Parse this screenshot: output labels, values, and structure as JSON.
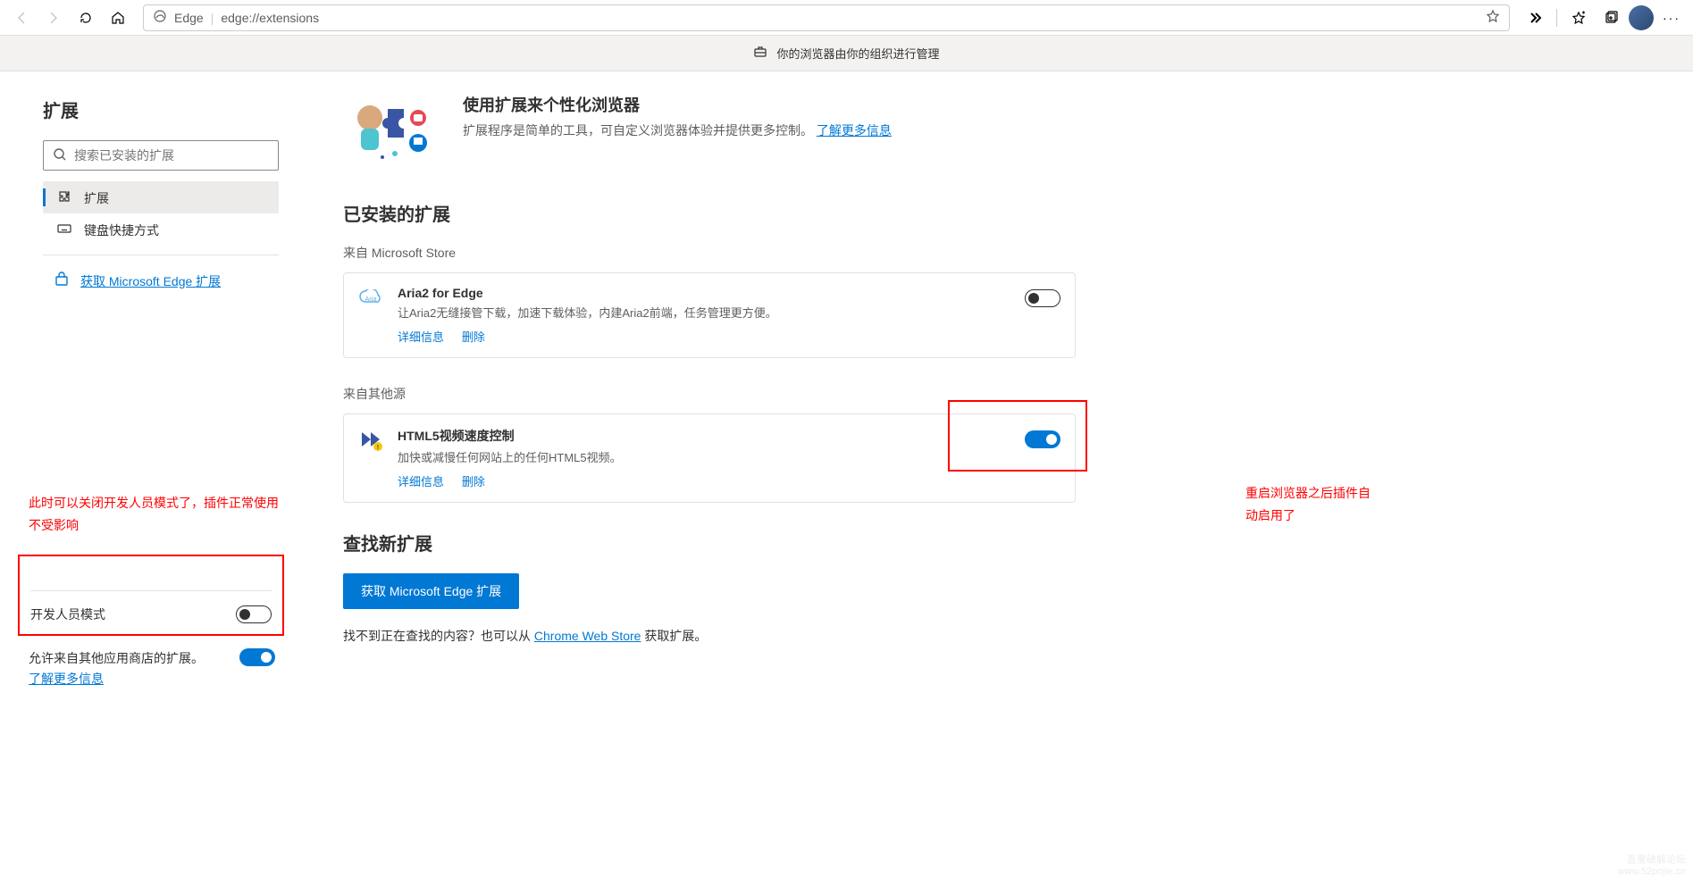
{
  "chrome": {
    "edge_label": "Edge",
    "url": "edge://extensions"
  },
  "banner": {
    "text": "你的浏览器由你的组织进行管理"
  },
  "sidebar": {
    "title": "扩展",
    "search_placeholder": "搜索已安装的扩展",
    "nav_extensions": "扩展",
    "nav_shortcuts": "键盘快捷方式",
    "get_link": "获取 Microsoft Edge 扩展",
    "annotation1": "此时可以关闭开发人员模式了，插件正常使用不受影响",
    "dev_mode_label": "开发人员模式",
    "allow_other_prefix": "允许来自其他应用商店的扩展。",
    "allow_other_link": "了解更多信息"
  },
  "main": {
    "hero_title": "使用扩展来个性化浏览器",
    "hero_desc": "扩展程序是简单的工具，可自定义浏览器体验并提供更多控制。",
    "hero_link": "了解更多信息",
    "installed_title": "已安装的扩展",
    "from_store": "来自 Microsoft Store",
    "from_other": "来自其他源",
    "ext1": {
      "title": "Aria2 for Edge",
      "desc": "让Aria2无缝接管下载，加速下载体验，内建Aria2前端，任务管理更方便。",
      "details": "详细信息",
      "remove": "删除"
    },
    "ext2": {
      "title": "HTML5视频速度控制",
      "desc": "加快或减慢任何网站上的任何HTML5视频。",
      "details": "详细信息",
      "remove": "删除"
    },
    "annotation2": "重启浏览器之后插件自动启用了",
    "find_title": "查找新扩展",
    "find_button": "获取 Microsoft Edge 扩展",
    "find_desc_prefix": "找不到正在查找的内容？也可以从 ",
    "find_desc_link": "Chrome Web Store",
    "find_desc_suffix": " 获取扩展。"
  },
  "watermark": {
    "l1": "吾爱破解论坛",
    "l2": "www.52pojie.cn"
  }
}
